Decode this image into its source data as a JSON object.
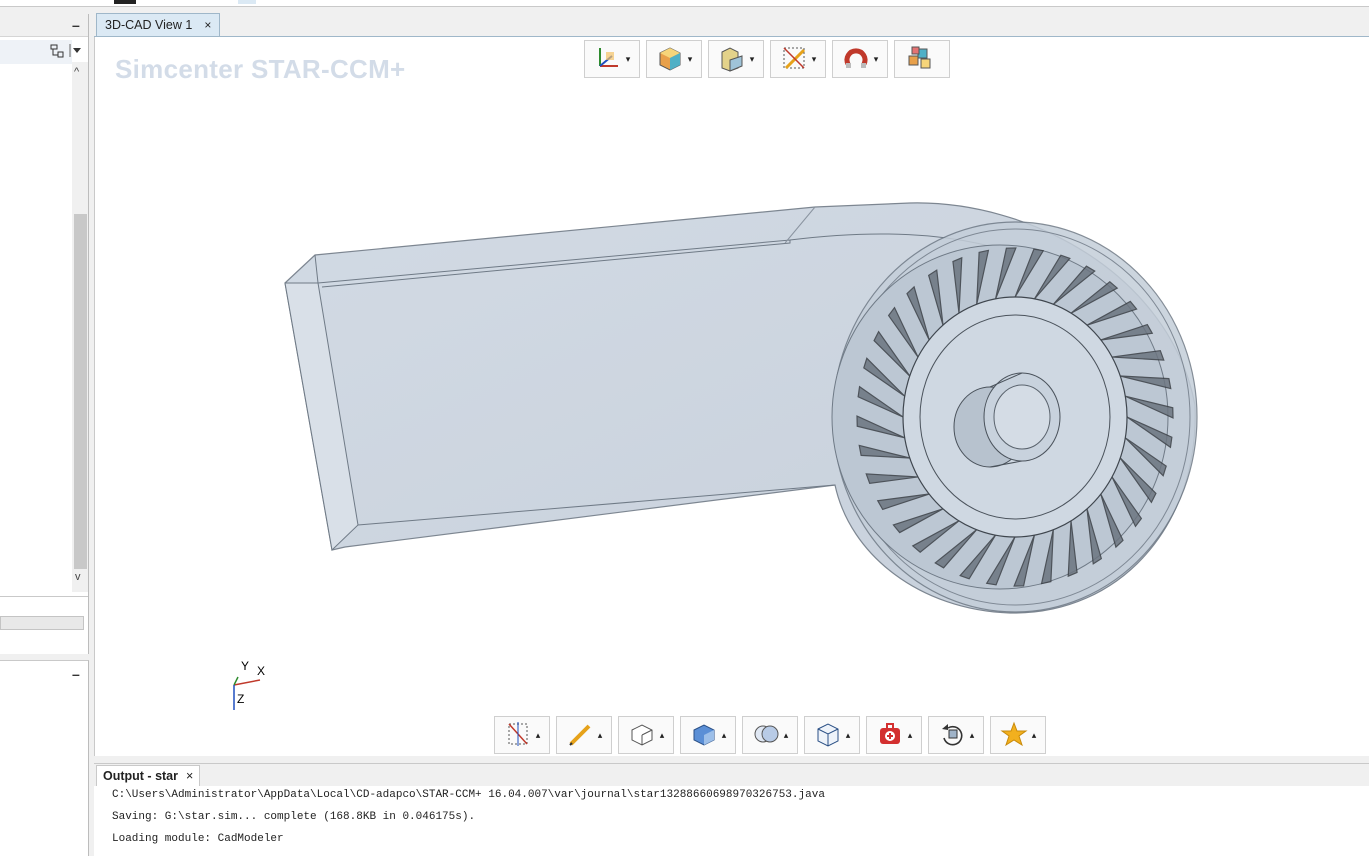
{
  "left_panel": {
    "minimize_label": "–",
    "lower_minimize_label": "–",
    "scroll_up": "^",
    "scroll_down": "v"
  },
  "view": {
    "tab_label": "3D-CAD View 1",
    "tab_close": "×",
    "brand": "Simcenter STAR-CCM+",
    "axes": {
      "y": "Y",
      "x": "X",
      "z": "Z"
    }
  },
  "top_toolbar": [
    {
      "icon": "coordinate-system-icon",
      "menu": "▾"
    },
    {
      "icon": "colored-cube-icon",
      "menu": "▾"
    },
    {
      "icon": "block-shape-icon",
      "menu": "▾"
    },
    {
      "icon": "pencil-plane-icon",
      "menu": "▾"
    },
    {
      "icon": "magnet-icon",
      "menu": "▾"
    },
    {
      "icon": "multi-cube-icon",
      "menu": ""
    }
  ],
  "bottom_toolbar": [
    {
      "icon": "sketch-plane-icon",
      "menu": "▴"
    },
    {
      "icon": "pencil-icon",
      "menu": "▴"
    },
    {
      "icon": "extrude-icon",
      "menu": "▴"
    },
    {
      "icon": "blue-extrude-icon",
      "menu": "▴"
    },
    {
      "icon": "boolean-icon",
      "menu": "▴"
    },
    {
      "icon": "cube-icon",
      "menu": "▴"
    },
    {
      "icon": "repair-kit-icon",
      "menu": "▴"
    },
    {
      "icon": "transform-icon",
      "menu": "▴"
    },
    {
      "icon": "star-icon",
      "menu": "▴"
    }
  ],
  "output": {
    "tab_label": "Output - star",
    "tab_close": "×",
    "lines": [
      "C:\\Users\\Administrator\\AppData\\Local\\CD-adapco\\STAR-CCM+ 16.04.007\\var\\journal\\star13288660698970326753.java",
      "Saving: G:\\star.sim... complete (168.8KB in 0.046175s).",
      "Loading module: CadModeler"
    ]
  },
  "colors": {
    "tab_active": "#dbe9f4",
    "brand": "#d3dce8",
    "model_fill": "#c9d3df",
    "model_edge": "#6f7a86"
  }
}
